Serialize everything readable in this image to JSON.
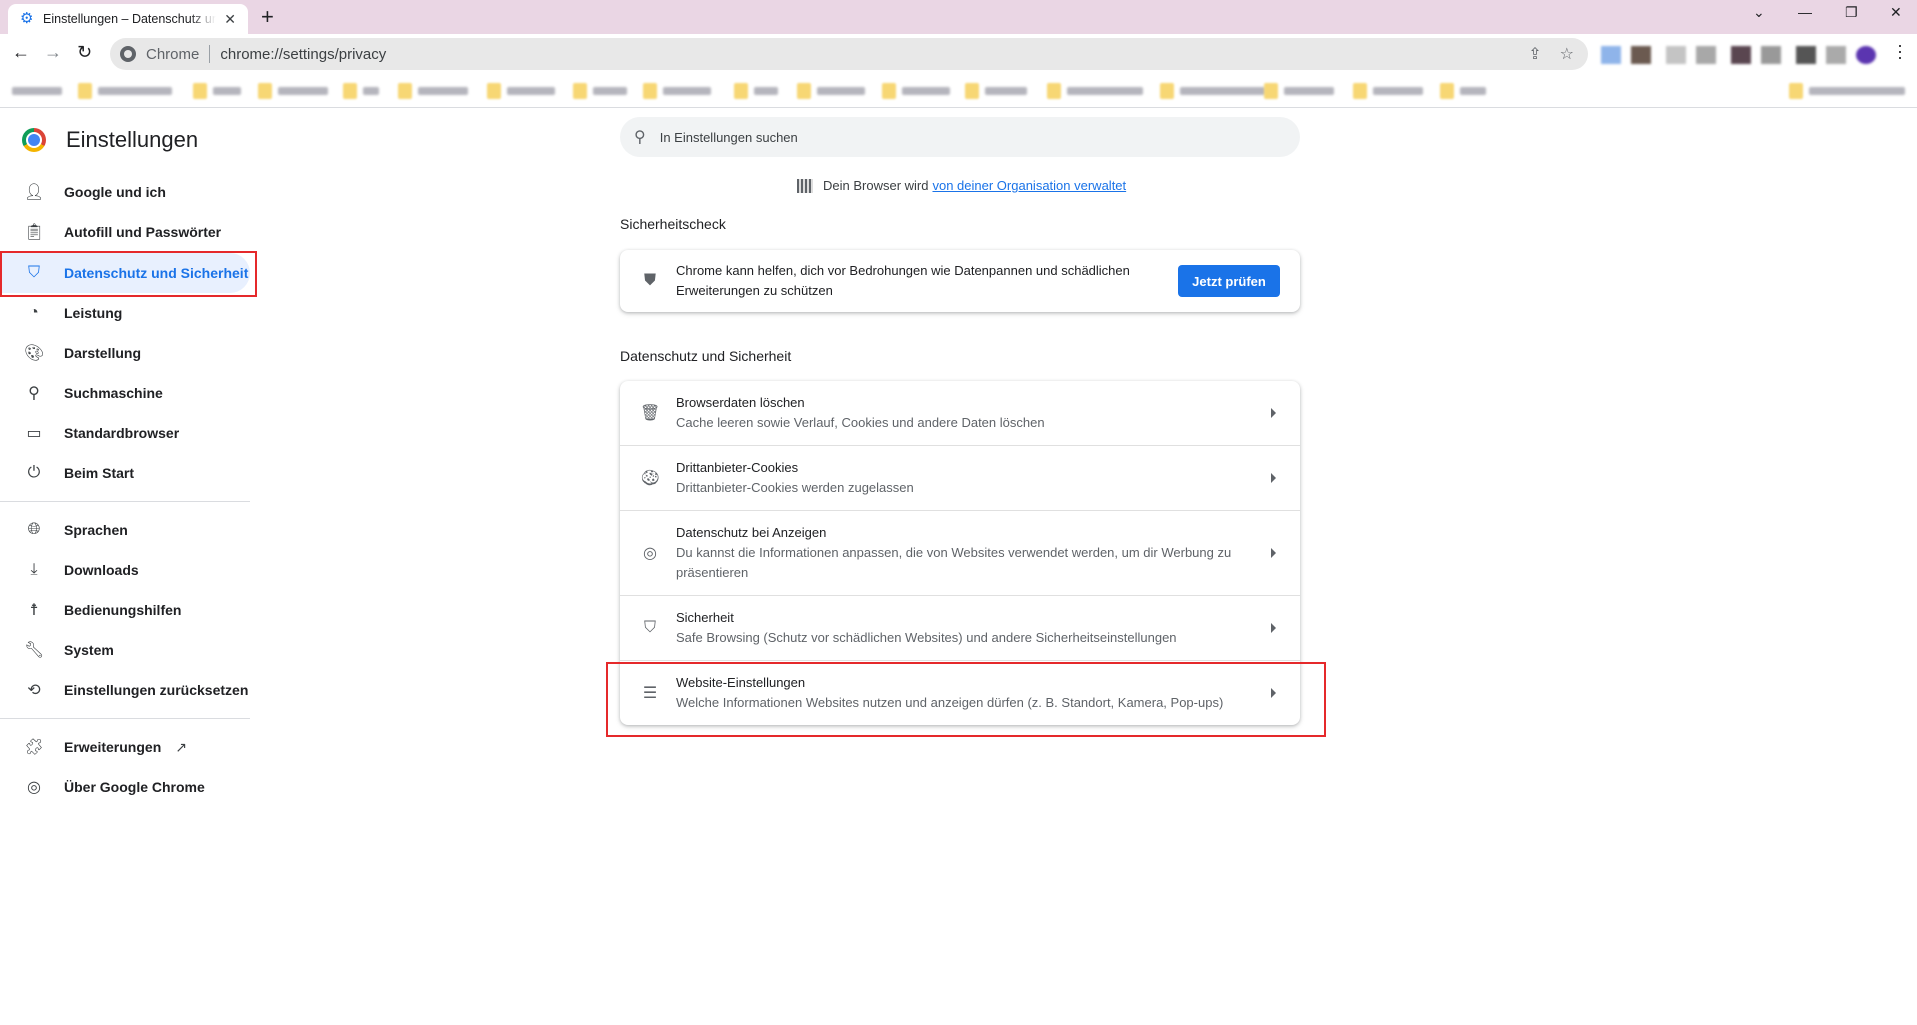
{
  "browser": {
    "tab_title": "Einstellungen – Datenschutz und Sicherheit",
    "new_tab_symbol": "+",
    "omnibox_chip": "Chrome",
    "url": "chrome://settings/privacy",
    "window_controls": {
      "tab_search": "⌄",
      "minimize": "—",
      "restore": "❐",
      "close": "✕"
    }
  },
  "sidebar": {
    "title": "Einstellungen",
    "items": [
      {
        "label": "Google und ich",
        "icon": "person-icon"
      },
      {
        "label": "Autofill und Passwörter",
        "icon": "clipboard-icon"
      },
      {
        "label": "Datenschutz und Sicherheit",
        "icon": "shield-icon",
        "active": true
      },
      {
        "label": "Leistung",
        "icon": "speedometer-icon"
      },
      {
        "label": "Darstellung",
        "icon": "palette-icon"
      },
      {
        "label": "Suchmaschine",
        "icon": "search-icon"
      },
      {
        "label": "Standardbrowser",
        "icon": "browser-window-icon"
      },
      {
        "label": "Beim Start",
        "icon": "power-icon"
      },
      {
        "label": "Sprachen",
        "icon": "globe-icon"
      },
      {
        "label": "Downloads",
        "icon": "download-icon"
      },
      {
        "label": "Bedienungshilfen",
        "icon": "accessibility-icon"
      },
      {
        "label": "System",
        "icon": "wrench-icon"
      },
      {
        "label": "Einstellungen zurücksetzen",
        "icon": "restore-icon"
      },
      {
        "label": "Erweiterungen",
        "icon": "puzzle-icon"
      },
      {
        "label": "Über Google Chrome",
        "icon": "chrome-icon"
      }
    ]
  },
  "search": {
    "placeholder": "In Einstellungen suchen"
  },
  "managed": {
    "text": "Dein Browser wird",
    "link": "von deiner Organisation verwaltet"
  },
  "safety_check": {
    "section_title": "Sicherheitscheck",
    "text": "Chrome kann helfen, dich vor Bedrohungen wie Datenpannen und schädlichen Erweiterungen zu schützen",
    "button": "Jetzt prüfen"
  },
  "privacy": {
    "section_title": "Datenschutz und Sicherheit",
    "rows": [
      {
        "title": "Browserdaten löschen",
        "subtitle": "Cache leeren sowie Verlauf, Cookies und andere Daten löschen"
      },
      {
        "title": "Drittanbieter-Cookies",
        "subtitle": "Drittanbieter-Cookies werden zugelassen"
      },
      {
        "title": "Datenschutz bei Anzeigen",
        "subtitle": "Du kannst die Informationen anpassen, die von Websites verwendet werden, um dir Werbung zu präsentieren"
      },
      {
        "title": "Sicherheit",
        "subtitle": "Safe Browsing (Schutz vor schädlichen Websites) und andere Sicherheitseinstellungen"
      },
      {
        "title": "Website-Einstellungen",
        "subtitle": "Welche Informationen Websites nutzen und anzeigen dürfen (z. B. Standort, Kamera, Pop-ups)"
      }
    ]
  },
  "colors": {
    "accent": "#1a73e8",
    "highlight": "#e8f0fe",
    "annotation": "#e5292b",
    "tabstrip": "#ead6e4"
  }
}
